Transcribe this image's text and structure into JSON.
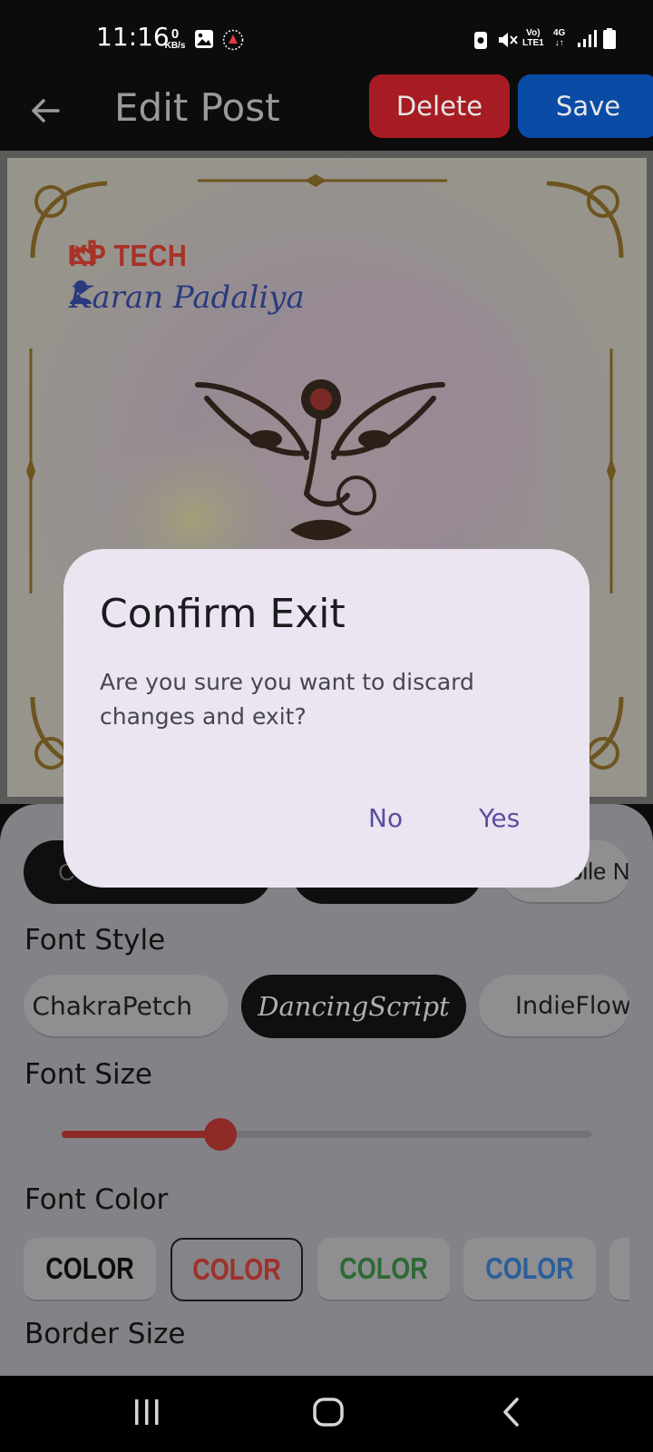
{
  "status_bar": {
    "time": "11:16",
    "net_speed_value": "0",
    "net_speed_unit": "KB/s",
    "network_label_top": "Vo)",
    "network_label_bottom": "LTE1",
    "network_type": "4G",
    "icons": [
      "gallery-icon",
      "notification-icon",
      "nfc-icon",
      "mute-icon",
      "signal-icon",
      "battery-icon"
    ]
  },
  "app_bar": {
    "title": "Edit Post",
    "delete_label": "Delete",
    "save_label": "Save",
    "colors": {
      "delete": "#a71c22",
      "save": "#0a4ba6"
    }
  },
  "post": {
    "company": "KP TECH",
    "person": "Karan Padaliya"
  },
  "editor": {
    "font_style_label": "Font Style",
    "font_size_label": "Font Size",
    "font_color_label": "Font Color",
    "border_size_label": "Border Size",
    "top_chip_partial_left": "C",
    "top_chip_partial_right": "bile N",
    "font_styles": [
      {
        "name": "ChakraPetch",
        "selected": false
      },
      {
        "name": "DancingScript",
        "selected": true
      },
      {
        "name": "IndieFlowe",
        "selected": false
      }
    ],
    "font_size_fraction": 0.3,
    "font_colors": [
      {
        "label": "COLOR",
        "color": "#0d0d0d",
        "selected": false
      },
      {
        "label": "COLOR",
        "color": "#a0302a",
        "selected": true
      },
      {
        "label": "COLOR",
        "color": "#2c6a33",
        "selected": false
      },
      {
        "label": "COLOR",
        "color": "#2b5f9a",
        "selected": false
      }
    ]
  },
  "dialog": {
    "title": "Confirm Exit",
    "message": "Are you sure you want to discard changes and exit?",
    "no_label": "No",
    "yes_label": "Yes",
    "accent": "#5b4ea0"
  }
}
